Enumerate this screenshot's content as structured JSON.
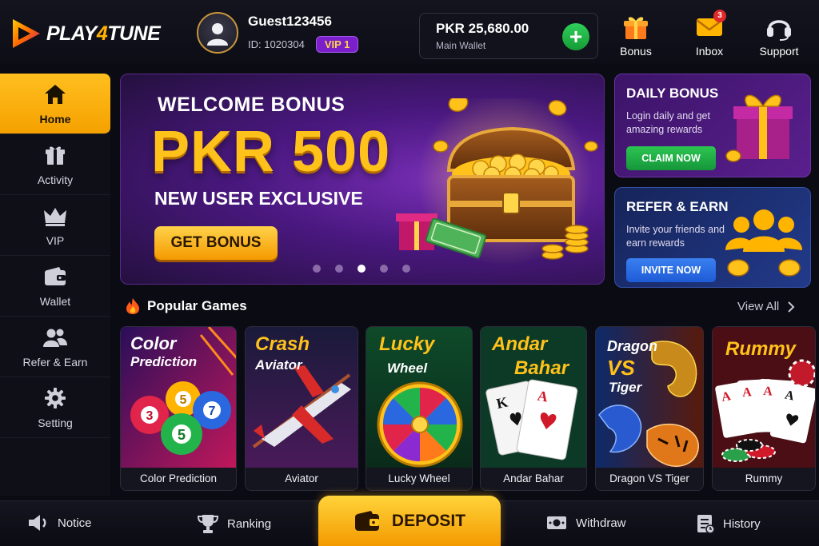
{
  "app": {
    "logo_text_1": "PLAY",
    "logo_text_2": "4",
    "logo_text_3": "TUNE"
  },
  "user": {
    "name": "Guest123456",
    "id": "ID: 1020304",
    "vip": "VIP 1"
  },
  "wallet": {
    "amount": "PKR  25,680.00",
    "label": "Main Wallet",
    "add_label": "+"
  },
  "top_actions": [
    {
      "label": "Bonus",
      "icon": "gift-icon"
    },
    {
      "label": "Inbox",
      "icon": "mail-icon",
      "badge": "3"
    },
    {
      "label": "Support",
      "icon": "headset-icon"
    }
  ],
  "sidebar": {
    "items": [
      {
        "label": "Home",
        "icon": "home-icon",
        "active": true
      },
      {
        "label": "Activity",
        "icon": "gift-icon"
      },
      {
        "label": "VIP",
        "icon": "crown-icon"
      },
      {
        "label": "Wallet",
        "icon": "wallet-icon"
      },
      {
        "label": "Refer & Earn",
        "icon": "users-icon"
      },
      {
        "label": "Setting",
        "icon": "gear-icon"
      }
    ]
  },
  "banner": {
    "title": "WELCOME BONUS",
    "amount": "PKR 500",
    "subtitle": "NEW USER EXCLUSIVE",
    "button": "GET BONUS",
    "slides": 5,
    "active_slide": 3
  },
  "promos": {
    "daily": {
      "title": "DAILY BONUS",
      "desc": "Login daily and get amazing rewards",
      "button": "CLAIM NOW"
    },
    "refer": {
      "title": "REFER & EARN",
      "desc": "Invite your friends and earn rewards",
      "button": "INVITE NOW"
    }
  },
  "games_section": {
    "title": "Popular Games",
    "view_all": "View All"
  },
  "games": [
    {
      "name": "Color Prediction",
      "t1": "Color",
      "t2": "Prediction"
    },
    {
      "name": "Aviator",
      "t1": "Crash",
      "t2": "Aviator"
    },
    {
      "name": "Lucky Wheel",
      "t1": "Lucky",
      "t2": "Wheel"
    },
    {
      "name": "Andar Bahar",
      "t1": "Andar",
      "t2": "Bahar"
    },
    {
      "name": "Dragon VS Tiger",
      "t1": "Dragon",
      "t2": "VS",
      "t3": "Tiger"
    },
    {
      "name": "Rummy",
      "t1": "Rummy",
      "t2": ""
    }
  ],
  "bottom_bar": {
    "notice": "Notice",
    "ranking": "Ranking",
    "deposit": "DEPOSIT",
    "withdraw": "Withdraw",
    "history": "History"
  },
  "colors": {
    "accent": "#ffb400",
    "vip": "#7a1fc9",
    "green": "#1fb444",
    "blue": "#2a68e0"
  }
}
